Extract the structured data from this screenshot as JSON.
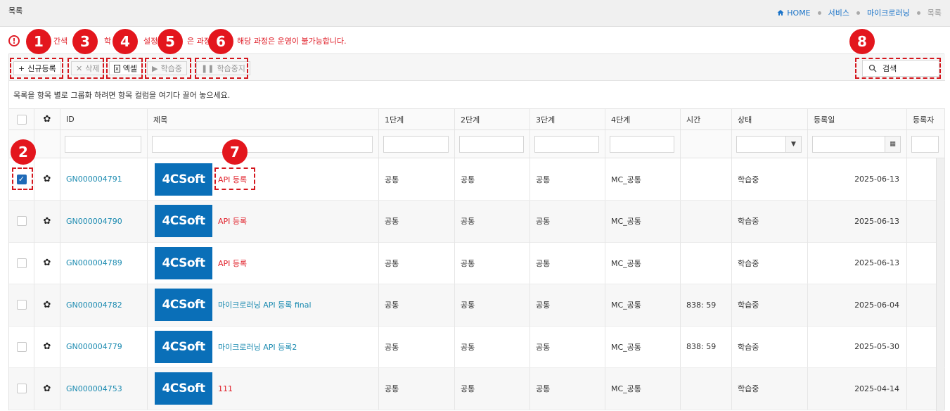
{
  "header": {
    "title": "목록",
    "breadcrumbs": [
      "HOME",
      "서비스",
      "마이크로러닝",
      "목록"
    ]
  },
  "notice": {
    "part1": "간색",
    "part2": "학",
    "part3": "설정",
    "part4": "은 과정",
    "part5": "해당 과정은 운영이 불가능합니다."
  },
  "toolbar": {
    "new": "신규등록",
    "delete": "삭제",
    "excel": "엑셀",
    "learning": "학습중",
    "stop": "학습중지",
    "search": "검색"
  },
  "group_hint": "목록을 항목 별로 그룹화 하려면 항목 컬럼을 여기다 끌어 놓으세요.",
  "columns": [
    "ID",
    "제목",
    "1단계",
    "2단계",
    "3단계",
    "4단계",
    "시간",
    "상태",
    "등록일",
    "등록자"
  ],
  "thumb_text": "4CSoft",
  "rows": [
    {
      "id": "GN000004791",
      "title": "API 등록",
      "title_color": "red",
      "s1": "공통",
      "s2": "공통",
      "s3": "공통",
      "s4": "MC_공통",
      "time": "",
      "status": "학습중",
      "date": "2025-06-13",
      "checked": true
    },
    {
      "id": "GN000004790",
      "title": "API 등록",
      "title_color": "red",
      "s1": "공통",
      "s2": "공통",
      "s3": "공통",
      "s4": "MC_공통",
      "time": "",
      "status": "학습중",
      "date": "2025-06-13",
      "checked": false
    },
    {
      "id": "GN000004789",
      "title": "API 등록",
      "title_color": "red",
      "s1": "공통",
      "s2": "공통",
      "s3": "공통",
      "s4": "MC_공통",
      "time": "",
      "status": "학습중",
      "date": "2025-06-13",
      "checked": false
    },
    {
      "id": "GN000004782",
      "title": "마이크로러닝 API 등록 final",
      "title_color": "blue",
      "s1": "공통",
      "s2": "공통",
      "s3": "공통",
      "s4": "MC_공통",
      "time": "838: 59",
      "status": "학습중",
      "date": "2025-06-04",
      "checked": false
    },
    {
      "id": "GN000004779",
      "title": "마이크로러닝 API 등록2",
      "title_color": "blue",
      "s1": "공통",
      "s2": "공통",
      "s3": "공통",
      "s4": "MC_공통",
      "time": "838: 59",
      "status": "학습중",
      "date": "2025-05-30",
      "checked": false
    },
    {
      "id": "GN000004753",
      "title": "111",
      "title_color": "red",
      "s1": "공통",
      "s2": "공통",
      "s3": "공통",
      "s4": "MC_공통",
      "time": "",
      "status": "학습중",
      "date": "2025-04-14",
      "checked": false
    }
  ],
  "markers": [
    "1",
    "2",
    "3",
    "4",
    "5",
    "6",
    "7",
    "8"
  ],
  "colors": {
    "accent": "#1a73c8",
    "danger": "#e0202a",
    "brand": "#0a6fb8"
  }
}
